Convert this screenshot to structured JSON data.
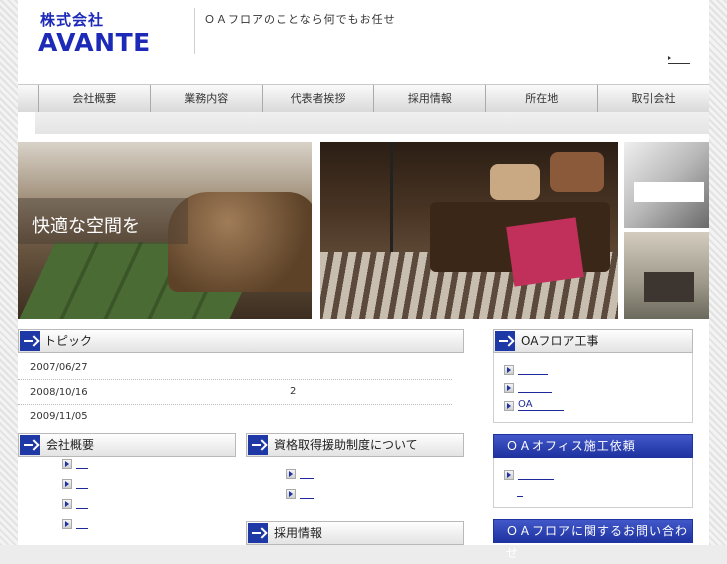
{
  "header": {
    "logo_sub": "株式会社",
    "logo_main": "AVANTE",
    "tagline": "ＯＡフロアのことなら何でもお任せ"
  },
  "nav": {
    "items": [
      "会社概要",
      "業務内容",
      "代表者挨拶",
      "採用情報",
      "所在地",
      "取引会社"
    ]
  },
  "hero": {
    "caption": "快適な空間を"
  },
  "topics": {
    "title": "トピック",
    "entries": [
      {
        "date": "2007/06/27",
        "text": ""
      },
      {
        "date": "2008/10/16",
        "text": "2"
      },
      {
        "date": "2009/11/05",
        "text": ""
      }
    ]
  },
  "company": {
    "title": "会社概要",
    "links": [
      "",
      "",
      "",
      ""
    ]
  },
  "qualification": {
    "title": "資格取得援助制度について",
    "links": [
      "",
      ""
    ]
  },
  "recruit": {
    "title": "採用情報"
  },
  "side": {
    "oafloor": {
      "title": "OAフロア工事",
      "links": [
        "",
        "",
        "OA"
      ]
    },
    "office_order": {
      "title": "ＯＡオフィス施工依頼",
      "links": [
        "",
        ""
      ]
    },
    "contact": {
      "title": "ＯＡフロアに関するお問い合わせ"
    }
  }
}
